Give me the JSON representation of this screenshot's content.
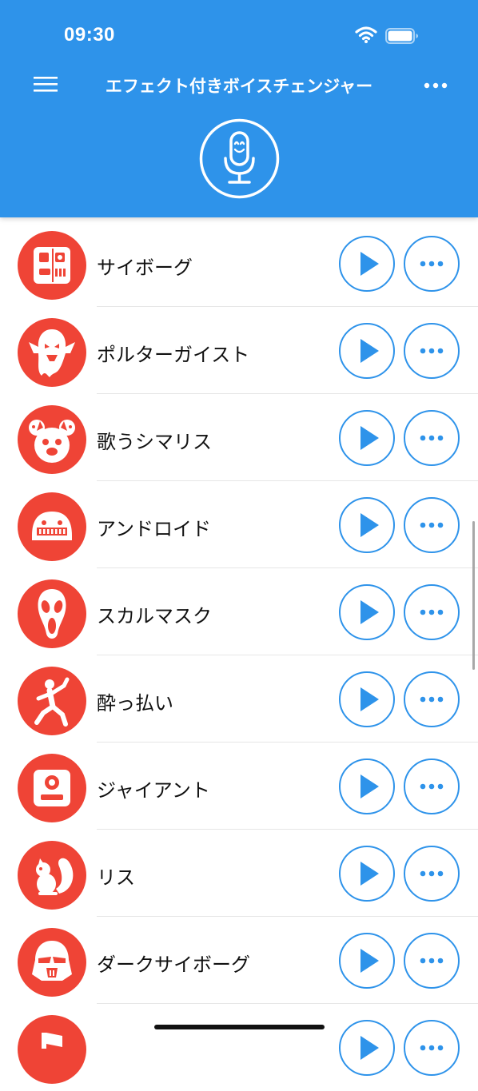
{
  "status_bar": {
    "time": "09:30",
    "wifi_icon": "wifi-icon",
    "battery_icon": "battery-icon"
  },
  "header": {
    "title": "エフェクト付きボイスチェンジャー",
    "menu_icon": "hamburger-menu-icon",
    "more_icon": "more-horizontal-icon",
    "record_icon": "microphone-icon",
    "color": "#2e93ea"
  },
  "effects": [
    {
      "label": "サイボーグ",
      "icon": "robot-face-icon"
    },
    {
      "label": "ポルターガイスト",
      "icon": "ghost-icon"
    },
    {
      "label": "歌うシマリス",
      "icon": "chipmunks-icon"
    },
    {
      "label": "アンドロイド",
      "icon": "android-robot-icon"
    },
    {
      "label": "スカルマスク",
      "icon": "scream-mask-icon"
    },
    {
      "label": "酔っ払い",
      "icon": "dancing-drunk-icon"
    },
    {
      "label": "ジャイアント",
      "icon": "giant-icon"
    },
    {
      "label": "リス",
      "icon": "squirrel-icon"
    },
    {
      "label": "ダークサイボーグ",
      "icon": "dark-cyborg-helmet-icon"
    },
    {
      "label": "",
      "icon": "partial-effect-icon"
    }
  ],
  "row_actions": {
    "play_icon": "play-icon",
    "options_icon": "ellipsis-icon"
  },
  "colors": {
    "accent": "#2e93ea",
    "effect_icon_bg": "#ef4436"
  }
}
